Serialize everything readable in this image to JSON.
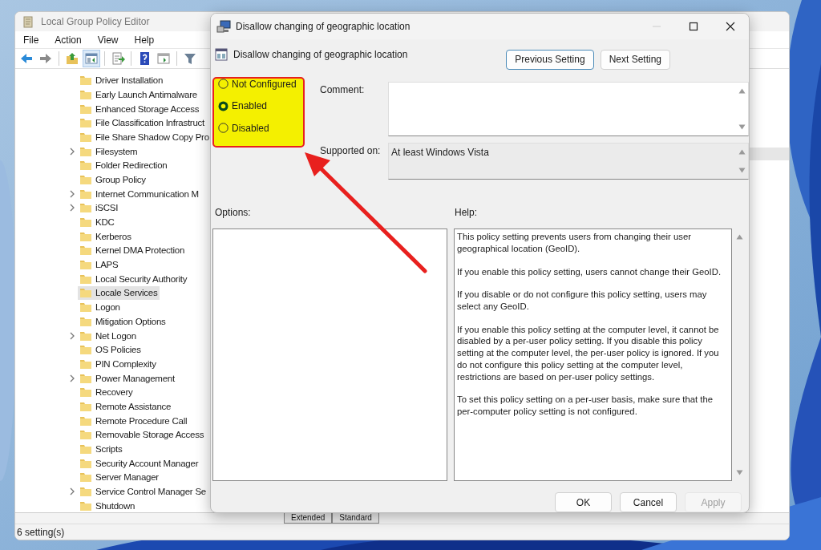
{
  "main_window": {
    "title": "Local Group Policy Editor",
    "menu": [
      "File",
      "Action",
      "View",
      "Help"
    ],
    "toolbar": [
      {
        "kind": "back",
        "pressed": false
      },
      {
        "kind": "forward",
        "pressed": false
      },
      {
        "kind": "up",
        "pressed": false
      },
      {
        "kind": "tree",
        "pressed": true
      },
      {
        "kind": "export",
        "pressed": false
      },
      {
        "kind": "help",
        "pressed": false
      },
      {
        "kind": "pane",
        "pressed": false
      },
      {
        "kind": "filter",
        "pressed": false
      }
    ],
    "tree": [
      {
        "label": "Driver Installation",
        "expandable": false,
        "selected": false
      },
      {
        "label": "Early Launch Antimalware",
        "expandable": false,
        "selected": false
      },
      {
        "label": "Enhanced Storage Access",
        "expandable": false,
        "selected": false
      },
      {
        "label": "File Classification Infrastruct",
        "expandable": false,
        "selected": false
      },
      {
        "label": "File Share Shadow Copy Pro",
        "expandable": false,
        "selected": false
      },
      {
        "label": "Filesystem",
        "expandable": true,
        "selected": false
      },
      {
        "label": "Folder Redirection",
        "expandable": false,
        "selected": false
      },
      {
        "label": "Group Policy",
        "expandable": false,
        "selected": false
      },
      {
        "label": "Internet Communication M",
        "expandable": true,
        "selected": false
      },
      {
        "label": "iSCSI",
        "expandable": true,
        "selected": false
      },
      {
        "label": "KDC",
        "expandable": false,
        "selected": false
      },
      {
        "label": "Kerberos",
        "expandable": false,
        "selected": false
      },
      {
        "label": "Kernel DMA Protection",
        "expandable": false,
        "selected": false
      },
      {
        "label": "LAPS",
        "expandable": false,
        "selected": false
      },
      {
        "label": "Local Security Authority",
        "expandable": false,
        "selected": false
      },
      {
        "label": "Locale Services",
        "expandable": false,
        "selected": true
      },
      {
        "label": "Logon",
        "expandable": false,
        "selected": false
      },
      {
        "label": "Mitigation Options",
        "expandable": false,
        "selected": false
      },
      {
        "label": "Net Logon",
        "expandable": true,
        "selected": false
      },
      {
        "label": "OS Policies",
        "expandable": false,
        "selected": false
      },
      {
        "label": "PIN Complexity",
        "expandable": false,
        "selected": false
      },
      {
        "label": "Power Management",
        "expandable": true,
        "selected": false
      },
      {
        "label": "Recovery",
        "expandable": false,
        "selected": false
      },
      {
        "label": "Remote Assistance",
        "expandable": false,
        "selected": false
      },
      {
        "label": "Remote Procedure Call",
        "expandable": false,
        "selected": false
      },
      {
        "label": "Removable Storage Access",
        "expandable": false,
        "selected": false
      },
      {
        "label": "Scripts",
        "expandable": false,
        "selected": false
      },
      {
        "label": "Security Account Manager",
        "expandable": false,
        "selected": false
      },
      {
        "label": "Server Manager",
        "expandable": false,
        "selected": false
      },
      {
        "label": "Service Control Manager Se",
        "expandable": true,
        "selected": false
      },
      {
        "label": "Shutdown",
        "expandable": false,
        "selected": false
      }
    ],
    "tabs": [
      "Extended",
      "Standard"
    ],
    "status_bar": "6 setting(s)"
  },
  "dialog": {
    "title": "Disallow changing of geographic location",
    "setting_name": "Disallow changing of geographic location",
    "nav_buttons": [
      {
        "label": "Previous Setting",
        "focused": true
      },
      {
        "label": "Next Setting",
        "focused": false
      }
    ],
    "state_options": [
      {
        "label": "Not Configured",
        "selected": false
      },
      {
        "label": "Enabled",
        "selected": true
      },
      {
        "label": "Disabled",
        "selected": false
      }
    ],
    "comment_label": "Comment:",
    "supported_on": {
      "label": "Supported on:",
      "value": "At least Windows Vista"
    },
    "options_label": "Options:",
    "help_label": "Help:",
    "help_text": [
      "This policy setting prevents users from changing their user geographical location (GeoID).",
      "If you enable this policy setting, users cannot change their GeoID.",
      "If you disable or do not configure this policy setting, users may select any GeoID.",
      "If you enable this policy setting at the computer level, it cannot be disabled by a per-user policy setting. If you disable this policy setting at the computer level, the per-user policy is ignored. If you do not configure this policy setting at the computer level, restrictions are based on per-user policy settings.",
      "To set this policy setting on a per-user basis, make sure that the per-computer policy setting is not configured."
    ],
    "buttons": [
      {
        "label": "OK",
        "disabled": false
      },
      {
        "label": "Cancel",
        "disabled": false
      },
      {
        "label": "Apply",
        "disabled": true
      }
    ]
  }
}
